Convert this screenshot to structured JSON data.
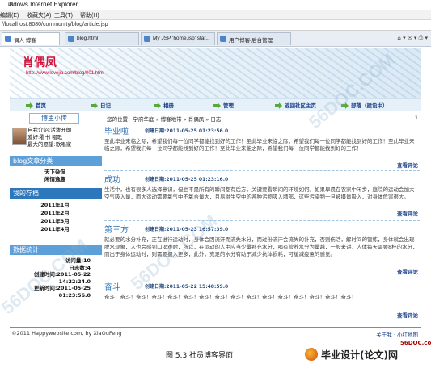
{
  "browser": {
    "title": "indows Internet Explorer",
    "menu": [
      "编辑(E)",
      "收藏夹(A)",
      "工具(T)",
      "帮助(H)"
    ],
    "address": "//localhost:8080/community/blog/article.jsp",
    "tabs": [
      "偶人 博客",
      "blog.html",
      "My JSP 'home.jsp' star...",
      "用户博客-后台管理"
    ]
  },
  "banner": {
    "blog_name": "肖偶凤",
    "url": "http://www.lovejia.com/blog/001.html"
  },
  "nav": [
    "首页",
    "日记",
    "相册",
    "管理",
    "返回社区主页",
    "部落（建设中）"
  ],
  "sidebar": {
    "profile_title": "博主小传",
    "profile_lines": [
      "自我介绍:活泼开朗",
      "爱好:看书 唱歌",
      "最大的愿望:歌唱家"
    ],
    "categories_head": "blog文章分类",
    "categories": [
      "天下杂侃",
      "闲情逸趣"
    ],
    "archive_head": "我的存档",
    "archive": [
      "2011年1月",
      "2011年2月",
      "2011年3月",
      "2011年4月"
    ],
    "stats_head": "数据统计",
    "stats": [
      "访问量:10",
      "日志数:4",
      "创建时间:2011-05-22",
      "14:22:24.0",
      "更新时间:2011-05-25",
      "01:23:56.0"
    ]
  },
  "content": {
    "breadcrumb": "您的位置：学府华庭 » 博客地带 » 肖偶凤 » 日志",
    "page_num": "1",
    "posts": [
      {
        "title": "毕业啦",
        "date": "创建日期:2011-05-25  01:23:56.0",
        "body": "至此毕业来临之际，希望我们每一位同学都能找到好的工作！至此毕业来临之际，希望我们每一位同学都能找到好的工作！至此毕业来临之际，希望我们每一位同学都能找到好的工作！至此毕业来临之际，希望我们每一位同学都能找到好的工作！",
        "more": "查看评论"
      },
      {
        "title": "成功",
        "date": "创建日期:2011-05-25  01:23:16.0",
        "body": "生活中，也有很多人选择意识，但也不是所有的瞬间都有后方，关键要看瞬间的环境如何。如果早晨在农家中闲步，庭院的运动会加大空气吸入量，而大运动需要氧气中不氧合量大，且易滋生空中的各种污物吸入肺部，这些污染物一旦被摄量吸入，对身体危害很大。",
        "more": "查看评论"
      },
      {
        "title": "第三方",
        "date": "创建日期:2011-05-23  16:57:39.0",
        "body": "就必要的水分补充，正在进行运动时，身体会因流汗而流失水分，而过份流汗会流失的补充，否则伤活，解时间的锻练，身体就会出现脱水现象，人也会感到口渴难耐，所以，在运动的人中应当少量补充水分，喝有营养水分为量越，一般来讲，人体每天需要8杯的水分，而出于身体运动时，则需要摄入更多，此外，充足的水分有助于减少抗体损耗，可缓减疲惫的感觉。",
        "more": "查看评论"
      },
      {
        "title": "奋斗",
        "date": "创建日期:2011-05-22  15:48:59.0",
        "body": "奋斗！奋斗！奋斗！奋斗！奋斗！奋斗！奋斗！奋斗！奋斗！奋斗！奋斗！奋斗！奋斗！奋斗！奋斗！奋斗！",
        "more": "查看评论"
      }
    ]
  },
  "footer": {
    "copyright": "©2011 Happywebsite.com, by XiaOuFeng",
    "links": "关于我 · 小红地图"
  },
  "caption": "图 5.3 社员博客界面",
  "brand": {
    "site": "56DOC.com",
    "name": "毕业设计(论文)网"
  },
  "watermark": "56DOC.COM"
}
